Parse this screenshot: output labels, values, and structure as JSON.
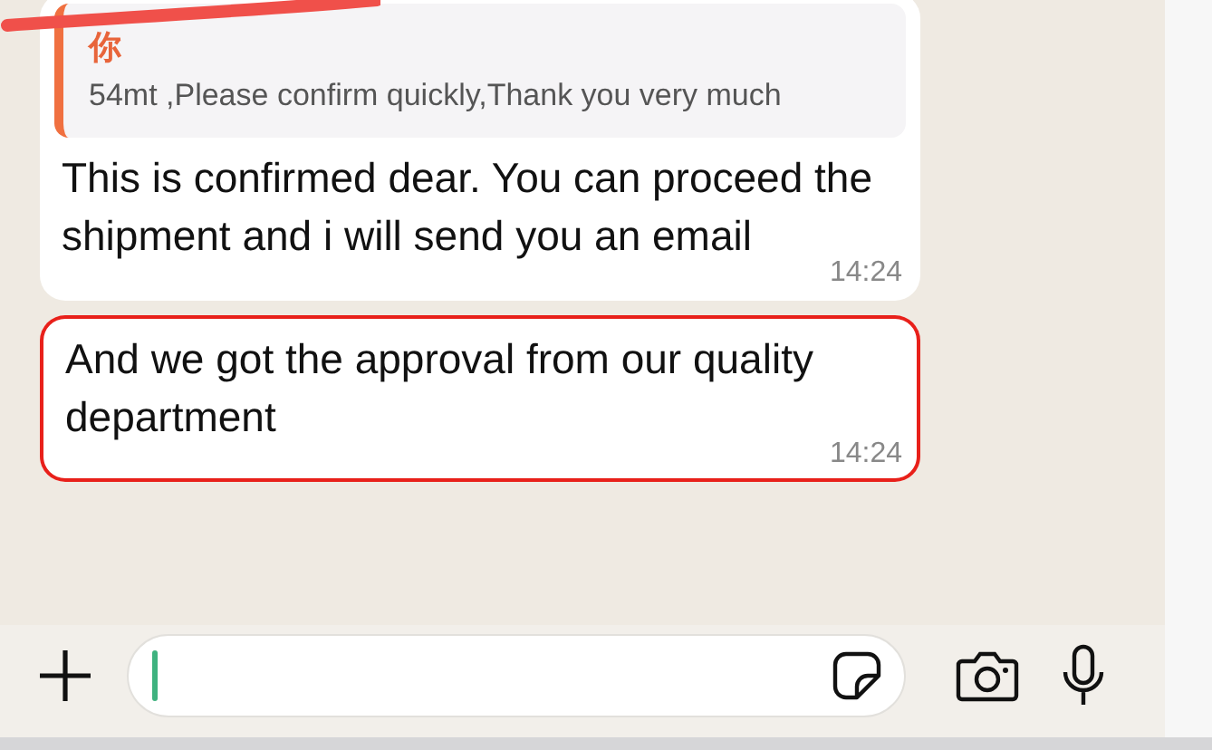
{
  "messages": [
    {
      "kind": "reply",
      "quote": {
        "author": "你",
        "text": "54mt ,Please confirm quickly,Thank you very much"
      },
      "text": "This is confirmed dear. You can proceed the shipment and i will send you an email",
      "time": "14:24",
      "highlighted": false
    },
    {
      "kind": "plain",
      "text": "And we got the approval from our quality department",
      "time": "14:24",
      "highlighted": true
    }
  ]
}
